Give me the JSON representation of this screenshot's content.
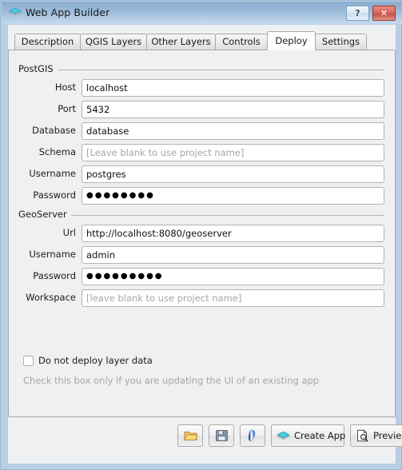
{
  "window": {
    "title": "Web App Builder",
    "icon": "cyan-diamond-app-icon",
    "help_button_label": "?",
    "close_button_label": "✕",
    "frame_color": "#b8cee4",
    "titlebar_gradient_top": "#8badcf",
    "titlebar_gradient_bottom": "#c3d9ee",
    "accent_color": "#27c6dd"
  },
  "tabs": [
    {
      "label": "Description",
      "active": false
    },
    {
      "label": "QGIS Layers",
      "active": false
    },
    {
      "label": "Other Layers",
      "active": false
    },
    {
      "label": "Controls",
      "active": false
    },
    {
      "label": "Deploy",
      "active": true
    },
    {
      "label": "Settings",
      "active": false
    }
  ],
  "postgis": {
    "group_title": "PostGIS",
    "fields": [
      {
        "label": "Host",
        "value": "localhost",
        "placeholder": "",
        "type": "text"
      },
      {
        "label": "Port",
        "value": "5432",
        "placeholder": "",
        "type": "text"
      },
      {
        "label": "Database",
        "value": "database",
        "placeholder": "",
        "type": "text"
      },
      {
        "label": "Schema",
        "value": "",
        "placeholder": "[Leave blank to use project name]",
        "type": "text"
      },
      {
        "label": "Username",
        "value": "postgres",
        "placeholder": "",
        "type": "text"
      },
      {
        "label": "Password",
        "value": "●●●●●●●●",
        "placeholder": "",
        "type": "password"
      }
    ]
  },
  "geoserver": {
    "group_title": "GeoServer",
    "fields": [
      {
        "label": "Url",
        "value": "http://localhost:8080/geoserver",
        "placeholder": "",
        "type": "text"
      },
      {
        "label": "Username",
        "value": "admin",
        "placeholder": "",
        "type": "text"
      },
      {
        "label": "Password",
        "value": "●●●●●●●●●",
        "placeholder": "",
        "type": "password"
      },
      {
        "label": "Workspace",
        "value": "",
        "placeholder": "[leave blank to use project name]",
        "type": "text"
      }
    ]
  },
  "options": {
    "no_deploy_checkbox_label": "Do not deploy layer data",
    "no_deploy_checked": false,
    "hint_text": "Check this box only if you are updating the UI of an existing app"
  },
  "buttonbar": [
    {
      "name": "open-button",
      "label": "",
      "icon": "folder-icon"
    },
    {
      "name": "save-button",
      "label": "",
      "icon": "floppy-disk-icon"
    },
    {
      "name": "qgis-button",
      "label": "",
      "icon": "qgis-logo-icon"
    },
    {
      "name": "create-app-button",
      "label": "Create App",
      "icon": "cyan-diamond-icon"
    },
    {
      "name": "preview-button",
      "label": "Preview",
      "icon": "page-magnifier-icon"
    }
  ]
}
